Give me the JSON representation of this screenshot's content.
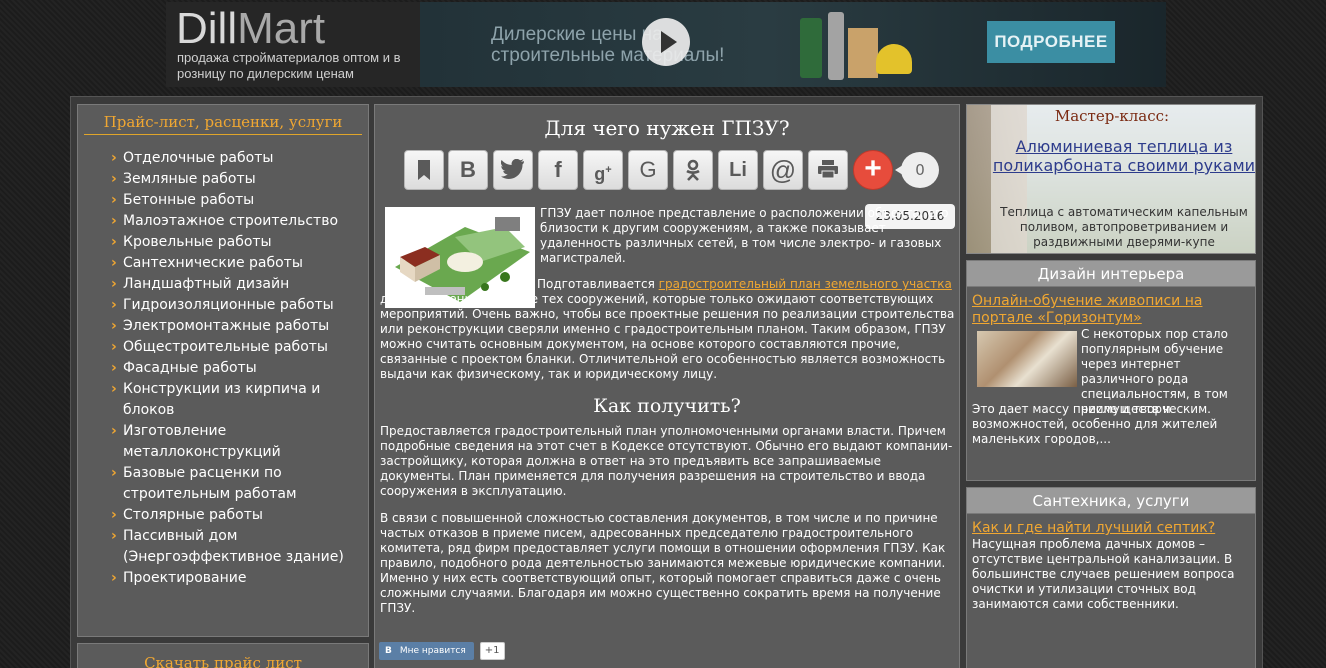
{
  "banner": {
    "logo_main": "Dill",
    "logo_accent": "Mart",
    "tagline": "продажа стройматериалов оптом и в розницу по дилерским ценам",
    "promo": "Дилерские цены на строительные материалы!",
    "button": "ПОДРОБНЕЕ"
  },
  "left": {
    "heading": "Прайс-лист, расценки, услуги",
    "items": [
      "Отделочные работы",
      "Земляные работы",
      "Бетонные работы",
      "Малоэтажное строительство",
      "Кровельные работы",
      "Сантехнические работы",
      "Ландшафтный дизайн",
      "Гидроизоляционные работы",
      "Электромонтажные работы",
      "Общестроительные работы",
      "Фасадные работы",
      "Конструкции из кирпича и блоков",
      "Изготовление металлоконструкций",
      "Базовые расценки по строительным работам",
      "Столярные работы",
      "Пассивный дом (Энергоэффективное здание)",
      "Проектирование"
    ],
    "download": "Скачать прайс лист"
  },
  "article": {
    "title": "Для чего нужен ГПЗУ?",
    "share_count": "0",
    "share_icons": [
      "bookmark-icon",
      "vk-icon",
      "twitter-icon",
      "facebook-icon",
      "googleplus-icon",
      "google-icon",
      "odnoklassniki-icon",
      "linkedin-icon",
      "mail-icon",
      "print-icon",
      "plus-icon"
    ],
    "date": "23.05.2016",
    "p1": "ГПЗУ дает полное представление о расположении объекта, его близости к другим сооружениям, а также показывает удаленность различных сетей, в том числе электро- и газовых магистралей.",
    "p2_before": "Подготавливается",
    "p2_link": "градостроительный план земельного участка",
    "p2_after": "для застроенных или же тех сооружений, которые только ожидают соответствующих мероприятий. Очень важно, чтобы все проектные решения по реализации строительства или реконструкции сверяли именно с градостроительным планом. Таким образом, ГПЗУ можно считать основным документом, на основе которого составляются прочие, связанные с проектом бланки. Отличительной его особенностью является возможность выдачи как физическому, так и юридическому лицу.",
    "subtitle": "Как получить?",
    "p3": "Предоставляется градостроительный план уполномоченными органами власти. Причем подробные сведения на этот счет в Кодексе отсутствуют. Обычно его выдают компании-застройщику, которая должна в ответ на это предъявить все запрашиваемые документы. План применяется для получения разрешения на строительство и ввода сооружения в эксплуатацию.",
    "p4": "В связи с повышенной сложностью составления документов, в том числе и по причине частых отказов в приеме писем, адресованных председателю градостроительного комитета, ряд фирм предоставляет услуги помощи в отношении оформления ГПЗУ. Как правило, подобного рода деятельностью занимаются межевые юридические компании. Именно у них есть соответствующий опыт, который помогает справиться даже с очень сложными случаями. Благодаря им можно существенно сократить время на получение ГПЗУ.",
    "vk_label": "Мне нравится",
    "vk_count": "+1"
  },
  "right": {
    "master": {
      "label": "Мастер-класс:",
      "title": "Алюминиевая теплица из поликарбоната своими руками",
      "desc": "Теплица с автоматическим капельным поливом, автопроветриванием и раздвижными дверями-купе"
    },
    "design": {
      "heading": "Дизайн интерьера",
      "link": "Онлайн-обучение живописи на портале «Горизонтум»",
      "text_side": "С некоторых пор стало популярным обучение через интернет различного рода специальностям, в том числе и творческим.",
      "text_bottom": "Это дает массу преимуществ и возможностей, особенно для жителей маленьких городов,..."
    },
    "plumb": {
      "heading": "Сантехника, услуги",
      "link": "Как и где найти лучший септик?",
      "text": "Насущная проблема дачных домов – отсутствие центральной канализации. В большинстве случаев решением вопроса очистки и утилизации сточных вод занимаются сами собственники."
    }
  },
  "colors": {
    "accent": "#f0a732",
    "panel": "#5b5b5b",
    "share_plus": "#e74c3c",
    "vk": "#5b7fa6"
  }
}
